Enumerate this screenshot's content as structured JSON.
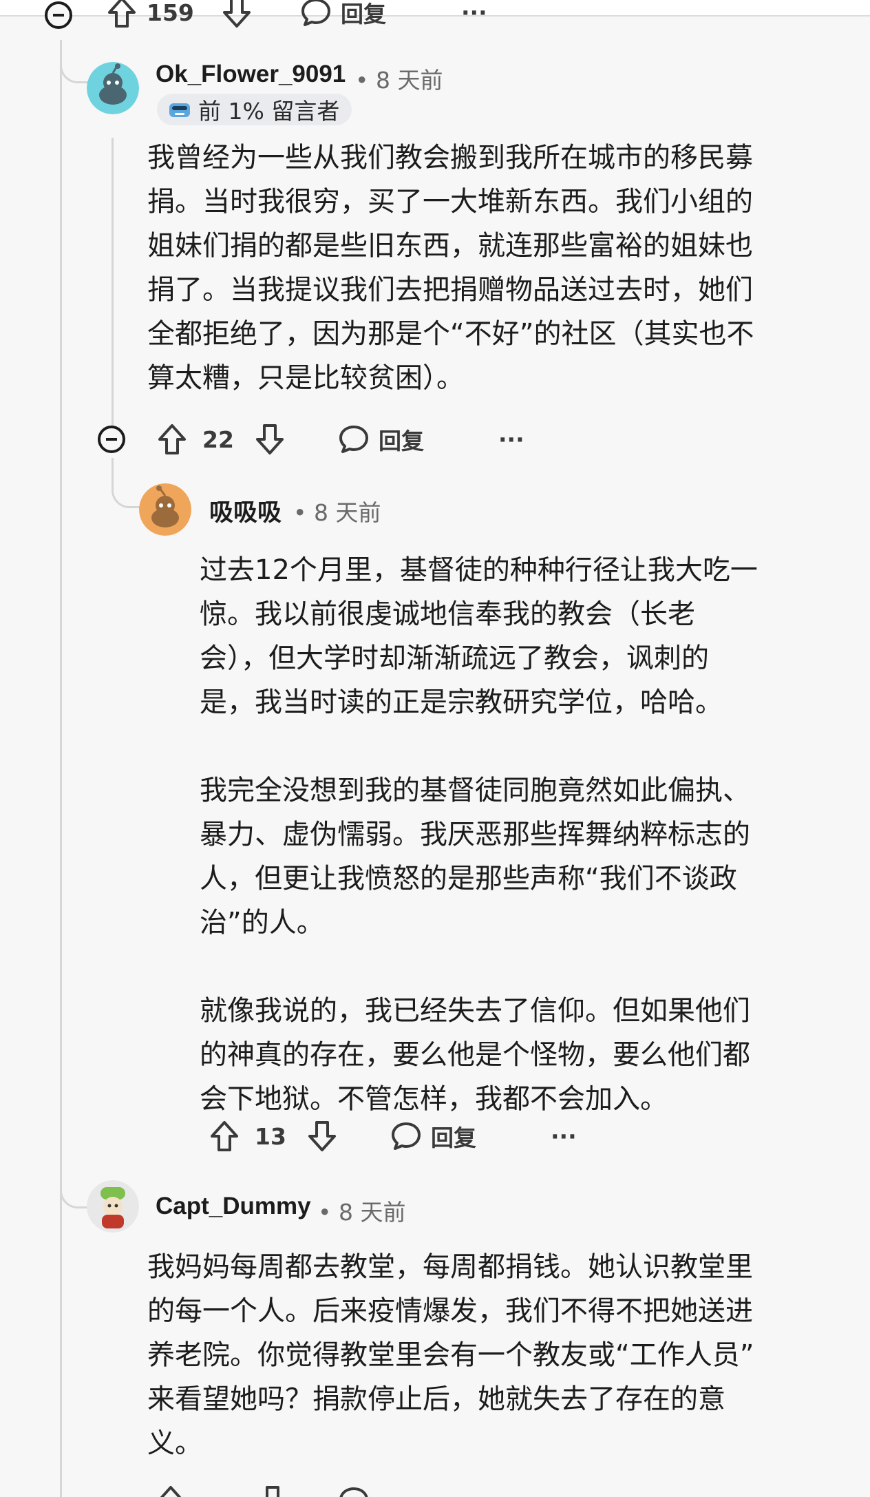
{
  "top_partial": {
    "upvotes": "159",
    "reply_label": "回复",
    "more": "···"
  },
  "comments": [
    {
      "username": "Ok_Flower_9091",
      "time": "• 8 天前",
      "flair": "前 1% 留言者",
      "body": "我曾经为一些从我们教会搬到我所在城市的移民募\n捐。当时我很穷，买了一大堆新东西。我们小组的\n姐妹们捐的都是些旧东西，就连那些富裕的姐妹也\n捐了。当我提议我们去把捐赠物品送过去时，她们\n全都拒绝了，因为那是个“不好”的社区（其实也不\n算太糟，只是比较贫困）。",
      "upvotes": "22",
      "reply_label": "回复",
      "more": "···",
      "avatar_color": "#6fd3df"
    },
    {
      "username": "吸吸吸",
      "time": "• 8 天前",
      "body": "过去12个月里，基督徒的种种行径让我大吃一\n惊。我以前很虔诚地信奉我的教会（长老\n会），但大学时却渐渐疏远了教会，讽刺的\n是，我当时读的正是宗教研究学位，哈哈。\n\n我完全没想到我的基督徒同胞竟然如此偏执、\n暴力、虚伪懦弱。我厌恶那些挥舞纳粹标志的\n人，但更让我愤怒的是那些声称“我们不谈政\n治”的人。\n\n就像我说的，我已经失去了信仰。但如果他们\n的神真的存在，要么他是个怪物，要么他们都\n会下地狱。不管怎样，我都不会加入。",
      "upvotes": "13",
      "reply_label": "回复",
      "more": "···",
      "avatar_color": "#f0a65a"
    },
    {
      "username": "Capt_Dummy",
      "time": "• 8 天前",
      "body": "我妈妈每周都去教堂，每周都捐钱。她认识教堂里\n的每一个人。后来疫情爆发，我们不得不把她送进\n养老院。你觉得教堂里会有一个教友或“工作人员”\n来看望她吗？捐款停止后，她就失去了存在的意\n义。",
      "avatar_color": "#e8e8e8"
    }
  ]
}
